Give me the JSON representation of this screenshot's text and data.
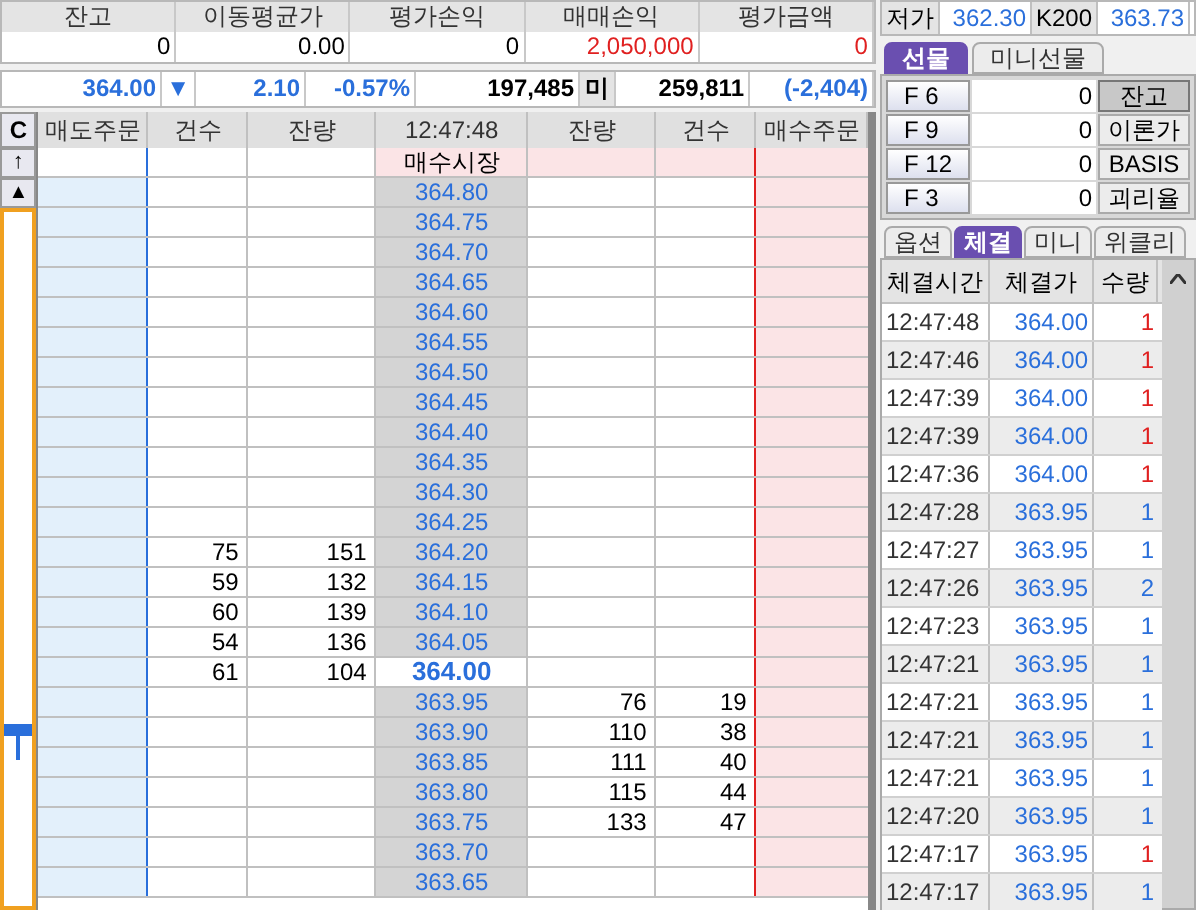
{
  "summary": [
    {
      "label": "잔고",
      "value": "0",
      "color": "#000000"
    },
    {
      "label": "이동평균가",
      "value": "0.00",
      "color": "#000000"
    },
    {
      "label": "평가손익",
      "value": "0",
      "color": "#000000"
    },
    {
      "label": "매매손익",
      "value": "2,050,000",
      "color": "#e02020"
    },
    {
      "label": "평가금액",
      "value": "0",
      "color": "#e02020"
    }
  ],
  "quote": [
    {
      "text": "364.00",
      "color": "#2a6fdb",
      "kind": "value"
    },
    {
      "text": "▼",
      "color": "#2a6fdb",
      "kind": "value"
    },
    {
      "text": "2.10",
      "color": "#2a6fdb",
      "kind": "value"
    },
    {
      "text": "-0.57%",
      "color": "#2a6fdb",
      "kind": "value"
    },
    {
      "text": "197,485",
      "color": "#000000",
      "kind": "value"
    },
    {
      "text": "미",
      "color": "#000000",
      "kind": "label"
    },
    {
      "text": "259,811",
      "color": "#000000",
      "kind": "value"
    },
    {
      "text": "(-2,404)",
      "color": "#2a6fdb",
      "kind": "value"
    }
  ],
  "book": {
    "clear_button": "C",
    "up_button": "↑",
    "top_button": "▲",
    "columns": [
      "매도주문",
      "건수",
      "잔량",
      "12:47:48",
      "잔량",
      "건수",
      "매수주문"
    ],
    "market_row": "매수시장",
    "rows": [
      {
        "price": "364.80",
        "current": false
      },
      {
        "price": "364.75",
        "current": false
      },
      {
        "price": "364.70",
        "current": false
      },
      {
        "price": "364.65",
        "current": false
      },
      {
        "price": "364.60",
        "current": false
      },
      {
        "price": "364.55",
        "current": false
      },
      {
        "price": "364.50",
        "current": false
      },
      {
        "price": "364.45",
        "current": false
      },
      {
        "price": "364.40",
        "current": false
      },
      {
        "price": "364.35",
        "current": false
      },
      {
        "price": "364.30",
        "current": false
      },
      {
        "price": "364.25",
        "current": false
      },
      {
        "price": "364.20",
        "current": false,
        "sell_count": "75",
        "sell_qty": "151"
      },
      {
        "price": "364.15",
        "current": false,
        "sell_count": "59",
        "sell_qty": "132"
      },
      {
        "price": "364.10",
        "current": false,
        "sell_count": "60",
        "sell_qty": "139"
      },
      {
        "price": "364.05",
        "current": false,
        "sell_count": "54",
        "sell_qty": "136"
      },
      {
        "price": "364.00",
        "current": true,
        "sell_count": "61",
        "sell_qty": "104"
      },
      {
        "price": "363.95",
        "current": false,
        "buy_qty": "76",
        "buy_count": "19"
      },
      {
        "price": "363.90",
        "current": false,
        "buy_qty": "110",
        "buy_count": "38"
      },
      {
        "price": "363.85",
        "current": false,
        "buy_qty": "111",
        "buy_count": "40"
      },
      {
        "price": "363.80",
        "current": false,
        "buy_qty": "115",
        "buy_count": "44"
      },
      {
        "price": "363.75",
        "current": false,
        "buy_qty": "133",
        "buy_count": "47"
      },
      {
        "price": "363.70",
        "current": false
      },
      {
        "price": "363.65",
        "current": false
      }
    ]
  },
  "info": [
    {
      "label": "저가",
      "value": "362.30"
    },
    {
      "label": "K200",
      "value": "363.73"
    }
  ],
  "futures_tabs": [
    {
      "label": "선물",
      "selected": true
    },
    {
      "label": "미니선물",
      "selected": false
    }
  ],
  "futures": [
    {
      "label": "F 6",
      "value": "0",
      "button": "잔고",
      "pressed": true
    },
    {
      "label": "F 9",
      "value": "0",
      "button": "이론가",
      "pressed": false
    },
    {
      "label": "F 12",
      "value": "0",
      "button": "BASIS",
      "pressed": false
    },
    {
      "label": "F 3",
      "value": "0",
      "button": "괴리율",
      "pressed": false
    }
  ],
  "trade_tabs": [
    {
      "label": "옵션",
      "selected": false
    },
    {
      "label": "체결",
      "selected": true
    },
    {
      "label": "미니",
      "selected": false
    },
    {
      "label": "위클리",
      "selected": false
    }
  ],
  "trades": {
    "columns": [
      "체결시간",
      "체결가",
      "수량"
    ],
    "rows": [
      {
        "time": "12:47:48",
        "price": "364.00",
        "qty": "1",
        "color": "#e02020"
      },
      {
        "time": "12:47:46",
        "price": "364.00",
        "qty": "1",
        "color": "#e02020"
      },
      {
        "time": "12:47:39",
        "price": "364.00",
        "qty": "1",
        "color": "#e02020"
      },
      {
        "time": "12:47:39",
        "price": "364.00",
        "qty": "1",
        "color": "#e02020"
      },
      {
        "time": "12:47:36",
        "price": "364.00",
        "qty": "1",
        "color": "#e02020"
      },
      {
        "time": "12:47:28",
        "price": "363.95",
        "qty": "1",
        "color": "#2a6fdb"
      },
      {
        "time": "12:47:27",
        "price": "363.95",
        "qty": "1",
        "color": "#2a6fdb"
      },
      {
        "time": "12:47:26",
        "price": "363.95",
        "qty": "2",
        "color": "#2a6fdb"
      },
      {
        "time": "12:47:23",
        "price": "363.95",
        "qty": "1",
        "color": "#2a6fdb"
      },
      {
        "time": "12:47:21",
        "price": "363.95",
        "qty": "1",
        "color": "#2a6fdb"
      },
      {
        "time": "12:47:21",
        "price": "363.95",
        "qty": "1",
        "color": "#2a6fdb"
      },
      {
        "time": "12:47:21",
        "price": "363.95",
        "qty": "1",
        "color": "#2a6fdb"
      },
      {
        "time": "12:47:21",
        "price": "363.95",
        "qty": "1",
        "color": "#2a6fdb"
      },
      {
        "time": "12:47:20",
        "price": "363.95",
        "qty": "1",
        "color": "#2a6fdb"
      },
      {
        "time": "12:47:17",
        "price": "363.95",
        "qty": "1",
        "color": "#e02020"
      },
      {
        "time": "12:47:17",
        "price": "363.95",
        "qty": "1",
        "color": "#2a6fdb"
      }
    ]
  }
}
